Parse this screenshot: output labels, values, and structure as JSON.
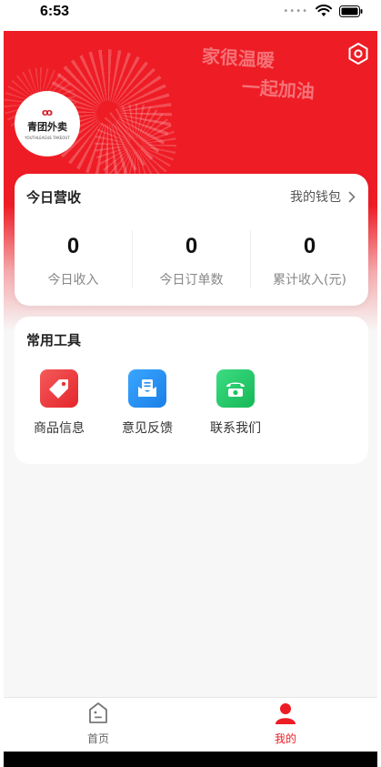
{
  "status_bar": {
    "time": "6:53"
  },
  "colors": {
    "primary_red": "#ee1c25",
    "tag_red": "#ef3b3b",
    "feedback_blue": "#1e8cf0",
    "contact_green": "#22c55e"
  },
  "hero": {
    "slogan_line1": "家很温暖",
    "slogan_line2": "一起加油"
  },
  "logo": {
    "mark": "ꝏ",
    "name": "青团外卖",
    "subtitle": "YOUTHLEAGUE TAKEOUT"
  },
  "revenue": {
    "title": "今日营收",
    "wallet_link": "我的钱包",
    "stats": [
      {
        "value": "0",
        "label": "今日收入"
      },
      {
        "value": "0",
        "label": "今日订单数"
      },
      {
        "value": "0",
        "label": "累计收入(元)"
      }
    ]
  },
  "tools": {
    "title": "常用工具",
    "items": [
      {
        "label": "商品信息",
        "icon": "tag-icon"
      },
      {
        "label": "意见反馈",
        "icon": "feedback-mail-icon"
      },
      {
        "label": "联系我们",
        "icon": "phone-icon"
      }
    ]
  },
  "tabbar": {
    "items": [
      {
        "label": "首页",
        "icon": "home-icon",
        "active": false
      },
      {
        "label": "我的",
        "icon": "user-icon",
        "active": true
      }
    ]
  }
}
